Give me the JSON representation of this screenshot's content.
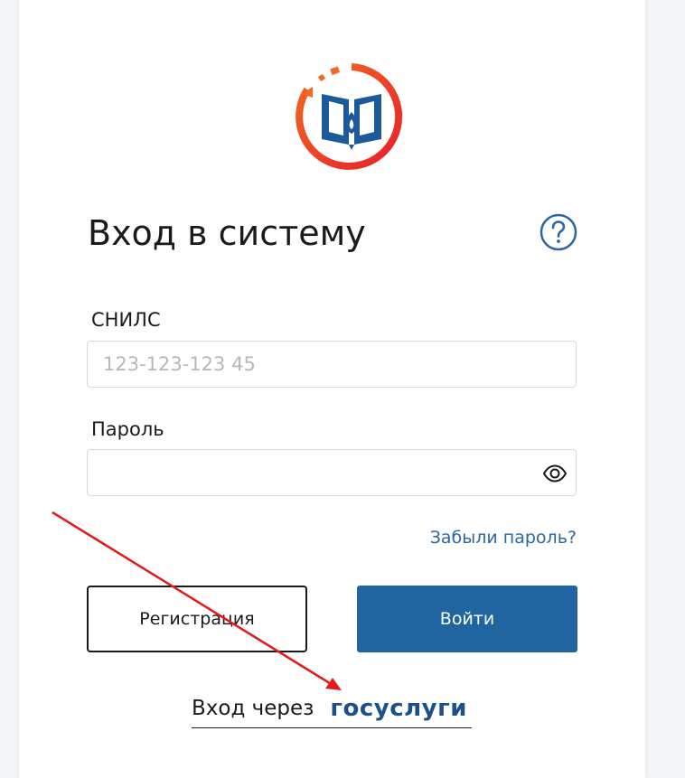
{
  "login": {
    "title": "Вход в систему",
    "snils_label": "СНИЛС",
    "snils_placeholder": "123-123-123 45",
    "password_label": "Пароль",
    "password_value": "",
    "forgot_link": "Забыли пароль?",
    "register_button": "Регистрация",
    "login_button": "Войти",
    "gosuslugi_prefix": "Вход через",
    "gosuslugi_brand": "госуслуги"
  },
  "icons": {
    "logo": "book-logo-icon",
    "help": "question-circle-icon",
    "password_toggle": "eye-icon"
  },
  "colors": {
    "primary": "#2064a0",
    "link": "#2a67a3",
    "brand": "#1d4f8a",
    "logo_ring": "#e8202a",
    "logo_ring_accent": "#f26a21",
    "annotation_arrow": "#e31b1b"
  }
}
